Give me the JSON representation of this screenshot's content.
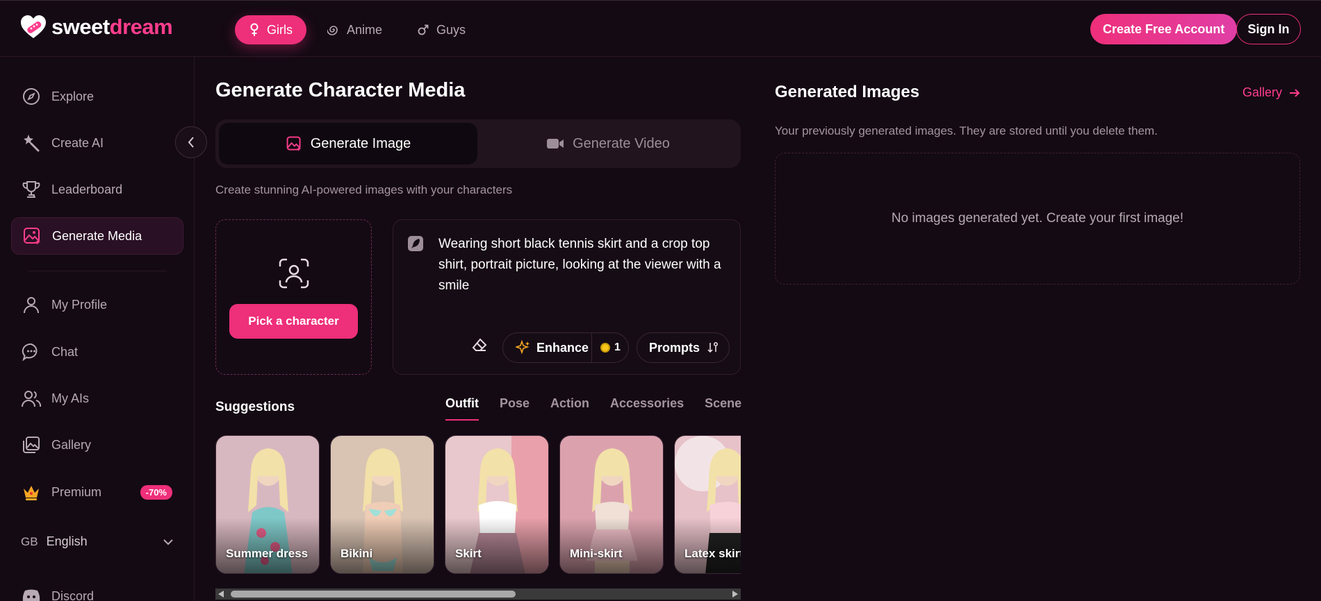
{
  "brand": {
    "part1": "sweet",
    "part2": "dream"
  },
  "nav": {
    "pills": [
      {
        "label": "Girls",
        "icon": "female-icon",
        "active": true
      },
      {
        "label": "Anime",
        "icon": "spiral-icon",
        "active": false
      },
      {
        "label": "Guys",
        "icon": "male-icon",
        "active": false
      }
    ]
  },
  "header": {
    "create_account": "Create Free Account",
    "sign_in": "Sign In"
  },
  "sidebar": {
    "items": [
      {
        "label": "Explore",
        "icon": "compass-icon"
      },
      {
        "label": "Create AI",
        "icon": "magic-wand-icon"
      },
      {
        "label": "Leaderboard",
        "icon": "trophy-icon"
      },
      {
        "label": "Generate Media",
        "icon": "image-sparkle-icon",
        "active": true
      },
      {
        "label": "My Profile",
        "icon": "user-icon"
      },
      {
        "label": "Chat",
        "icon": "chat-bubble-icon"
      },
      {
        "label": "My AIs",
        "icon": "users-icon"
      },
      {
        "label": "Gallery",
        "icon": "gallery-icon"
      },
      {
        "label": "Premium",
        "icon": "crown-icon",
        "badge": "-70%"
      }
    ],
    "language": {
      "code": "GB",
      "label": "English"
    },
    "discord": "Discord"
  },
  "main": {
    "title": "Generate Character Media",
    "tabs": [
      {
        "label": "Generate Image",
        "icon": "image-sparkle-icon",
        "active": true
      },
      {
        "label": "Generate Video",
        "icon": "video-camera-icon",
        "active": false
      }
    ],
    "subtitle": "Create stunning AI-powered images with your characters",
    "pick_character": "Pick a character",
    "prompt_text": "Wearing short black tennis skirt and a crop top shirt, portrait picture, looking at the viewer with a smile",
    "enhance": {
      "label": "Enhance",
      "cost": "1"
    },
    "prompts_label": "Prompts",
    "suggestions": {
      "title": "Suggestions",
      "tabs": [
        "Outfit",
        "Pose",
        "Action",
        "Accessories",
        "Scene"
      ],
      "active_tab": "Outfit",
      "cards": [
        {
          "label": "Summer dress",
          "color1": "#d8b8c0",
          "color2": "#7fc8c8"
        },
        {
          "label": "Bikini",
          "color1": "#d9c3b3",
          "color2": "#9fe0d8"
        },
        {
          "label": "Skirt",
          "color1": "#e8c8cc",
          "color2": "#b98a9a"
        },
        {
          "label": "Mini-skirt",
          "color1": "#dba2ae",
          "color2": "#f0c0c8"
        },
        {
          "label": "Latex skirt",
          "color1": "#e7c2c9",
          "color2": "#222222"
        }
      ]
    }
  },
  "generated": {
    "title": "Generated Images",
    "gallery_link": "Gallery",
    "subtitle": "Your previously generated images. They are stored until you delete them.",
    "empty_message": "No images generated yet. Create your first image!"
  },
  "colors": {
    "accent": "#ee2f7a",
    "background": "#140a14"
  }
}
